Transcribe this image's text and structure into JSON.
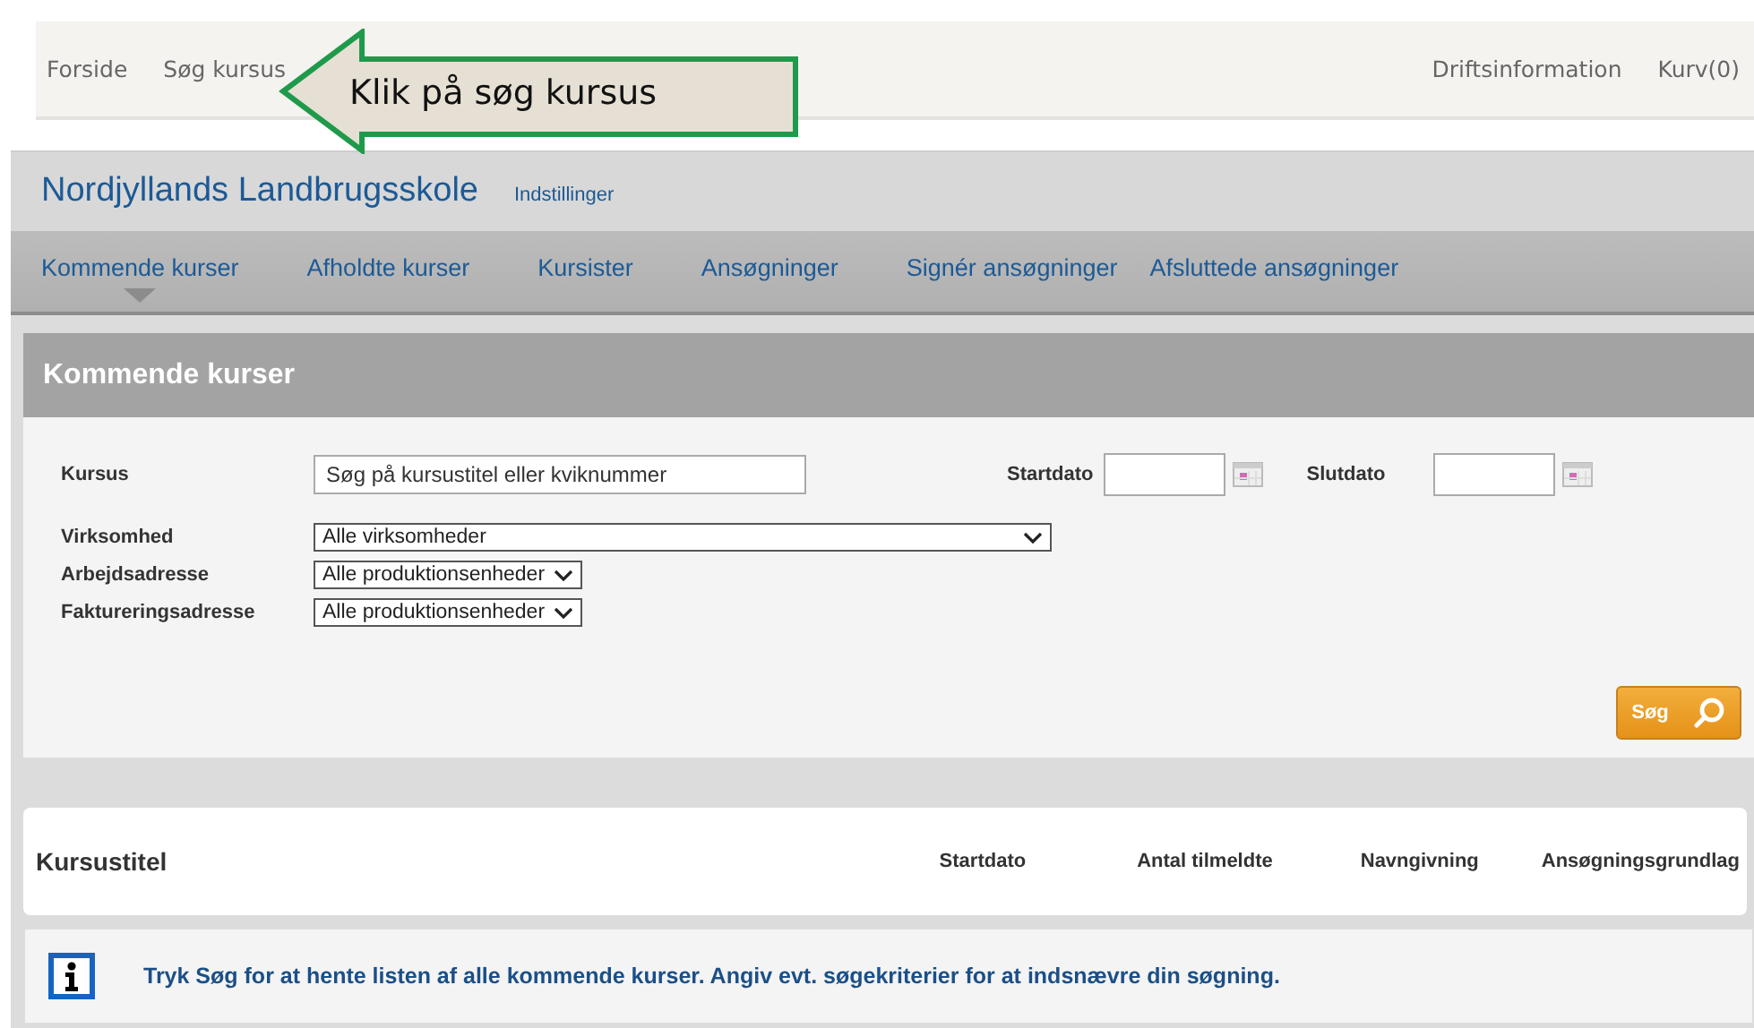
{
  "top_nav": {
    "left": [
      {
        "label": "Forside"
      },
      {
        "label": "Søg kursus"
      }
    ],
    "right": [
      {
        "label": "Driftsinformation"
      },
      {
        "label": "Kurv(0)"
      }
    ]
  },
  "callout": {
    "text": "Klik på søg kursus"
  },
  "header": {
    "title": "Nordjyllands Landbrugsskole",
    "link": "Indstillinger"
  },
  "tabs": [
    {
      "label": "Kommende kurser",
      "selected": true
    },
    {
      "label": "Afholdte kurser",
      "selected": false
    },
    {
      "label": "Kursister",
      "selected": false
    },
    {
      "label": "Ansøgninger",
      "selected": false
    },
    {
      "label": "Signér ansøgninger",
      "selected": false
    },
    {
      "label": "Afsluttede ansøgninger",
      "selected": false
    }
  ],
  "panel": {
    "title": "Kommende kurser",
    "course_field": {
      "label": "Kursus",
      "placeholder": "Søg på kursustitel eller kviknummer"
    },
    "start_date": {
      "label": "Startdato"
    },
    "end_date": {
      "label": "Slutdato"
    },
    "dropdowns": [
      {
        "label": "Virksomhed",
        "value": "Alle virksomheder",
        "kind": "wide"
      },
      {
        "label": "Arbejdsadresse",
        "value": "Alle produktionsenheder",
        "kind": "narrow"
      },
      {
        "label": "Faktureringsadresse",
        "value": "Alle produktionsenheder",
        "kind": "narrow"
      }
    ],
    "search_button": "Søg"
  },
  "table": {
    "columns": [
      "Kursustitel",
      "Startdato",
      "Antal tilmeldte",
      "Navngivning",
      "Ansøgningsgrundlag"
    ]
  },
  "info_message": "Tryk Søg for at hente listen af alle kommende kurser. Angiv evt. søgekriterier for at indsnævre din søgning."
}
